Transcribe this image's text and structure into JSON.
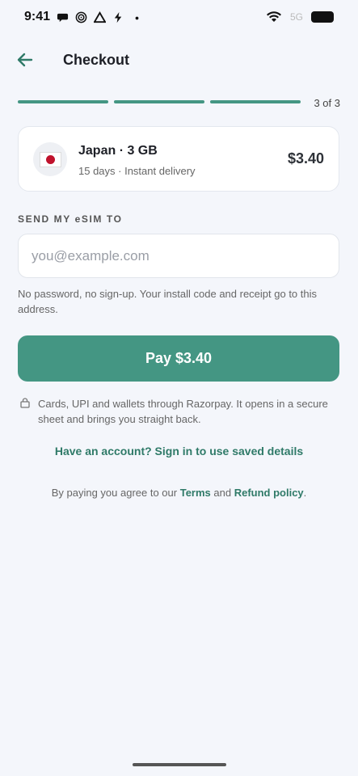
{
  "status_bar": {
    "time": "9:41",
    "network_text": "5G",
    "icons": [
      "chat-bubble-icon",
      "target-icon",
      "triangle-icon",
      "bolt-icon",
      "dot-icon",
      "wifi-icon",
      "battery-icon"
    ]
  },
  "header": {
    "title": "Checkout",
    "back_icon": "arrow-left-icon"
  },
  "progress": {
    "current_step": 3,
    "total_steps": 3,
    "step_label": "3 of 3",
    "fill_fraction": 1.0
  },
  "plan": {
    "country_flag": "japan-flag",
    "name": "Japan · 3 GB",
    "meta": "15 days · Instant delivery",
    "price": "$3.40"
  },
  "form": {
    "label": "SEND MY eSIM TO",
    "email_value": "",
    "email_placeholder": "you@example.com",
    "hint": "No password, no sign-up. Your install code and receipt go to this address."
  },
  "pay_button": {
    "label": "Pay $3.40"
  },
  "secure_note": {
    "icon": "lock-icon",
    "text": "Cards, UPI and wallets through Razorpay. It opens in a secure sheet and brings you straight back."
  },
  "signin_link": "Have an account? Sign in to use saved details",
  "legal": {
    "prefix": "By paying you agree to our ",
    "terms": "Terms",
    "and": " and ",
    "refund": "Refund policy",
    "suffix": "."
  },
  "colors": {
    "accent": "#449683",
    "link": "#2f7a68",
    "background": "#f4f6fb",
    "flag_red": "#c0122c"
  }
}
